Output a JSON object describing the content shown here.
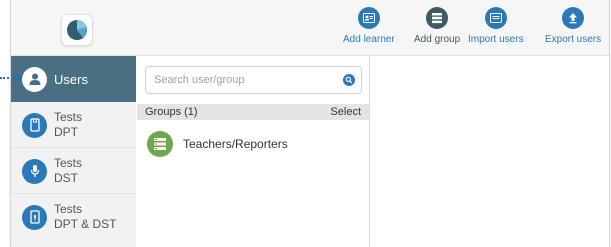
{
  "colors": {
    "accent": "#2b79b8",
    "nav_active": "#4a6f83",
    "group_green": "#6ea84a"
  },
  "toolbar": {
    "logo_icon": "pie-chart-icon",
    "buttons": [
      {
        "label": "Add learner",
        "icon": "add-learner-icon"
      },
      {
        "label": "Add group",
        "icon": "add-group-icon"
      },
      {
        "label": "Import users",
        "icon": "import-users-icon"
      },
      {
        "label": "Export users",
        "icon": "export-users-icon"
      }
    ]
  },
  "nav": {
    "items": [
      {
        "label": "Users",
        "icon": "user-icon",
        "active": true
      },
      {
        "line1": "Tests",
        "line2": "DPT",
        "icon": "tablet-icon"
      },
      {
        "line1": "Tests",
        "line2": "DST",
        "icon": "microphone-icon"
      },
      {
        "line1": "Tests",
        "line2": "DPT & DST",
        "icon": "tablet-audio-icon"
      }
    ]
  },
  "search": {
    "placeholder": "Search user/group",
    "value": ""
  },
  "groups": {
    "header": "Groups (1)",
    "select_label": "Select",
    "items": [
      {
        "name": "Teachers/Reporters",
        "icon": "group-list-icon"
      }
    ]
  }
}
